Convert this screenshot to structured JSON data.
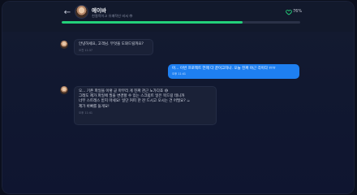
{
  "header": {
    "name": "에이바",
    "subtitle": "친절적이고 유쾌적인 비서 ",
    "progress_percent": 76,
    "progress_label": "76%",
    "accent_color": "#23d07a"
  },
  "messages": [
    {
      "from": "assistant",
      "text": "안녕하세요, 고객님. 무엇을 도와드릴까요?",
      "time": "오전 11:37"
    },
    {
      "from": "user",
      "text": "아... 이번 프로젝트 언제 다 끝이고자나. 오늘 진짜 야근 각이다 ㅠㅠ",
      "time": "오후 11:41"
    },
    {
      "from": "assistant",
      "text": "오... 기존 파일을 이렇 곧 마무리 게 진짜 관근 노가다죠 😅\n그래도 제가 파일에 필을 변경할 수 있는 스크립트 일은 목드링 테니까\n너무 스트레스 받지 마세요! 일단 커피 한 잔 드시고 오시는 건 어떨요? ☕\n제가 바빠를 들게요!",
      "time": "오후 11:41"
    }
  ],
  "icons": {
    "back": "back-arrow-icon",
    "avatar": "avatar",
    "heart": "heart-icon"
  }
}
